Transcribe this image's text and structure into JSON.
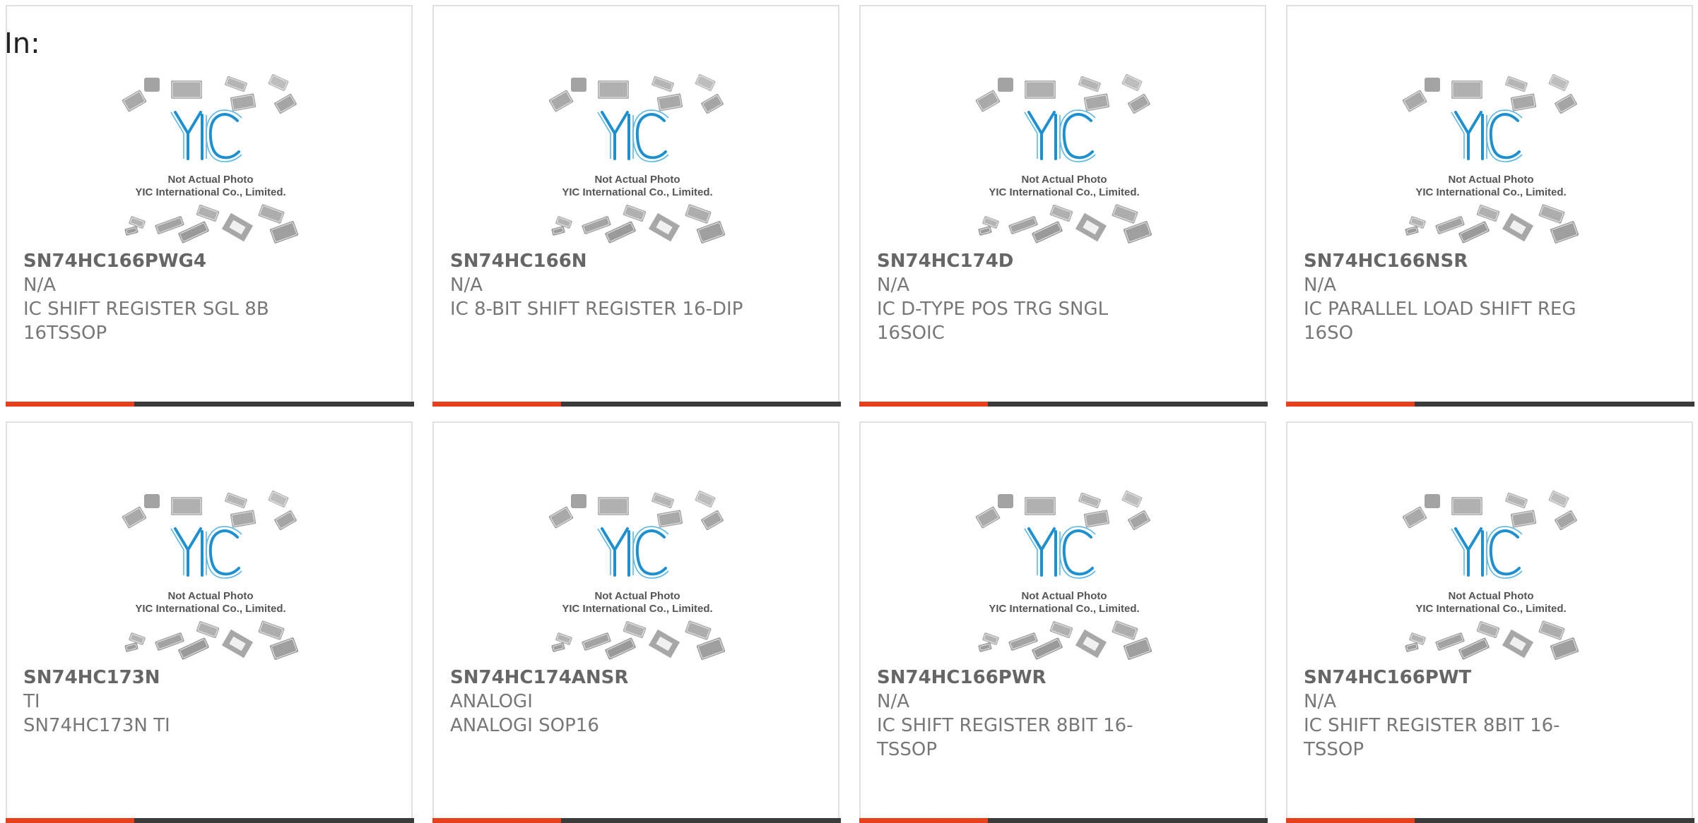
{
  "page": {
    "filter_label": "In:"
  },
  "placeholder": {
    "logo_text": "YIC",
    "line1": "Not Actual Photo",
    "line2": "YIC International Co., Limited."
  },
  "colors": {
    "accent": "#e8401c",
    "bar": "#3b3b3b",
    "logo_blue": "#1e90d0",
    "text": "#666666"
  },
  "products": [
    {
      "part": "SN74HC166PWG4",
      "manufacturer": "N/A",
      "description": "IC SHIFT REGISTER SGL 8B 16TSSOP"
    },
    {
      "part": "SN74HC166N",
      "manufacturer": "N/A",
      "description": "IC 8-BIT SHIFT REGISTER 16-DIP"
    },
    {
      "part": "SN74HC174D",
      "manufacturer": "N/A",
      "description": "IC D-TYPE POS TRG SNGL 16SOIC"
    },
    {
      "part": "SN74HC166NSR",
      "manufacturer": "N/A",
      "description": "IC PARALLEL LOAD SHIFT REG 16SO"
    },
    {
      "part": "SN74HC173N",
      "manufacturer": "TI",
      "description": "SN74HC173N TI"
    },
    {
      "part": "SN74HC174ANSR",
      "manufacturer": "ANALOGI",
      "description": "ANALOGI SOP16"
    },
    {
      "part": "SN74HC166PWR",
      "manufacturer": "N/A",
      "description": "IC SHIFT REGISTER 8BIT 16-TSSOP"
    },
    {
      "part": "SN74HC166PWT",
      "manufacturer": "N/A",
      "description": "IC SHIFT REGISTER 8BIT 16-TSSOP"
    }
  ]
}
